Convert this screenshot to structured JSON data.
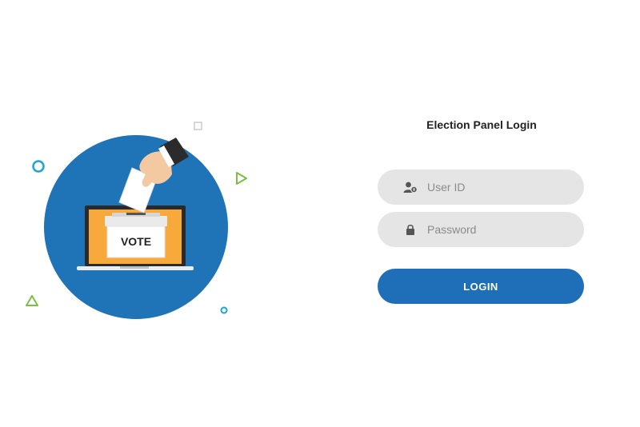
{
  "illustration": {
    "ballot_text": "VOTE",
    "icon": "ballot-box-laptop-illustration",
    "colors": {
      "circle": "#1f73b7",
      "box": "#f7a93b",
      "accent_green": "#7bc043",
      "accent_cyan": "#1aa7d6"
    }
  },
  "login": {
    "title": "Election Panel Login",
    "userid_placeholder": "User ID",
    "password_placeholder": "Password",
    "login_label": "LOGIN",
    "colors": {
      "button": "#1e6fb8",
      "field_bg": "#e5e5e5"
    }
  },
  "icons": {
    "user": "user-id-icon",
    "password": "lock-icon"
  }
}
